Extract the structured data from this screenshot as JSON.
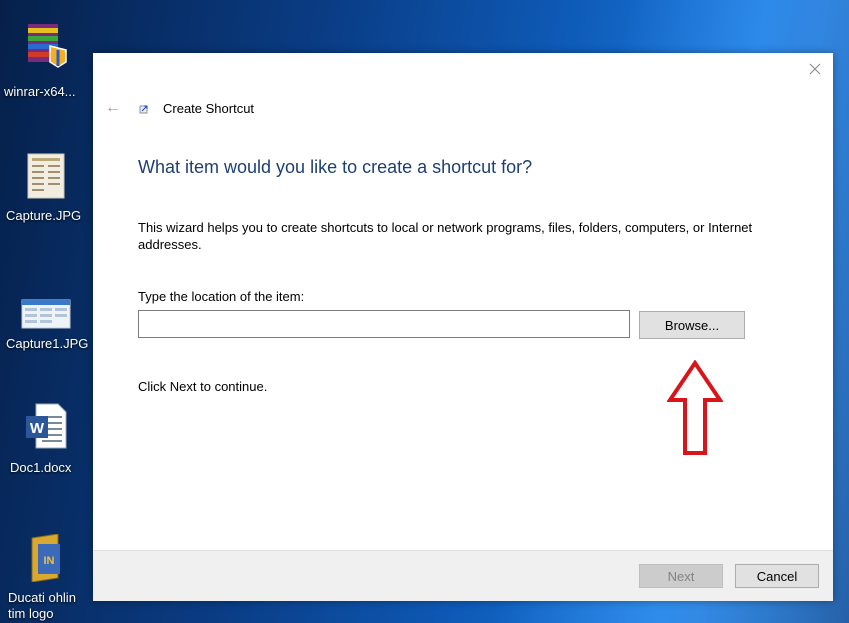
{
  "desktop": {
    "icons": [
      {
        "label": "winrar-x64...",
        "icon": "winrar-icon"
      },
      {
        "label": "Capture.JPG",
        "icon": "image-file-icon"
      },
      {
        "label": "Capture1.JPG",
        "icon": "image-file-icon"
      },
      {
        "label": "Doc1.docx",
        "icon": "word-document-icon"
      },
      {
        "label": "Ducati ohlin tim logo",
        "icon": "folder-icon"
      }
    ]
  },
  "dialog": {
    "title": "Create Shortcut",
    "heading": "What item would you like to create a shortcut for?",
    "description": "This wizard helps you to create shortcuts to local or network programs, files, folders, computers, or Internet addresses.",
    "location_label": "Type the location of the item:",
    "location_value": "",
    "browse_label": "Browse...",
    "next_hint": "Click Next to continue.",
    "buttons": {
      "next": "Next",
      "cancel": "Cancel"
    }
  },
  "colors": {
    "heading": "#1e3f73",
    "annotation_arrow": "#d9151c",
    "footer_bg": "#f0f0f0"
  }
}
